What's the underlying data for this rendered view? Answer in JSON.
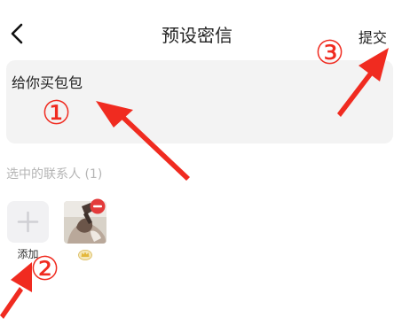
{
  "header": {
    "title": "预设密信",
    "submit_label": "提交"
  },
  "message": {
    "value": "给你买包包"
  },
  "contacts": {
    "section_title": "选中的联系人 (1)",
    "add_label": "添加"
  },
  "annotations": {
    "marker_1": "①",
    "marker_2": "②",
    "marker_3": "③"
  },
  "colors": {
    "annotation_red": "#f02b20",
    "input_bg": "#f3f3f3",
    "muted_text": "#b5b5b5"
  },
  "icons": {
    "back": "chevron-left-icon",
    "add": "plus-icon",
    "remove": "minus-circle-icon",
    "badge": "crown-icon"
  }
}
